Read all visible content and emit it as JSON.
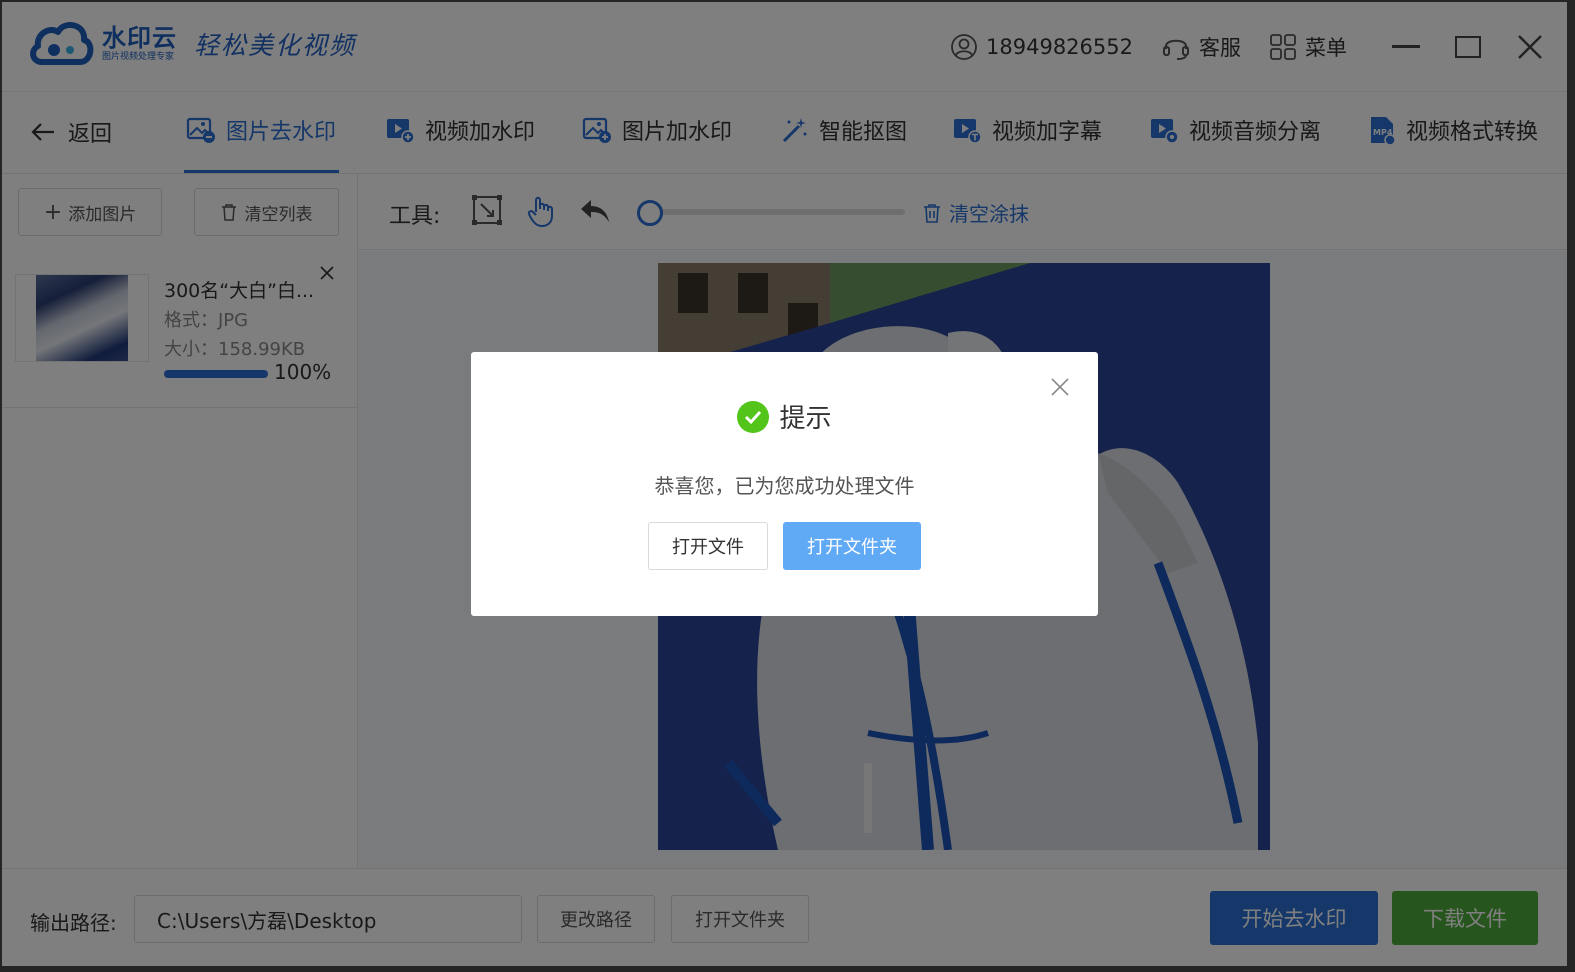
{
  "app": {
    "brand": "水印云",
    "brand_sub": "图片视频处理专家",
    "slogan": "轻松美化视频"
  },
  "titlebar": {
    "phone": "18949826552",
    "service": "客服",
    "menu": "菜单"
  },
  "nav": {
    "back": "返回",
    "tabs": [
      {
        "label": "图片去水印",
        "icon": "image-remove-icon"
      },
      {
        "label": "视频加水印",
        "icon": "video-add-icon"
      },
      {
        "label": "图片加水印",
        "icon": "image-add-icon"
      },
      {
        "label": "智能抠图",
        "icon": "magic-wand-icon"
      },
      {
        "label": "视频加字幕",
        "icon": "video-subtitle-icon"
      },
      {
        "label": "视频音频分离",
        "icon": "video-audio-icon"
      },
      {
        "label": "视频格式转换",
        "icon": "mp4-icon"
      }
    ],
    "active_tab": "图片去水印"
  },
  "sidebar": {
    "add_button": "添加图片",
    "clear_button": "清空列表",
    "files": [
      {
        "name": "300名“大白”白...",
        "format": "格式：JPG",
        "size": "大小：158.99KB",
        "progress_label": "100%",
        "progress": 1.0
      }
    ]
  },
  "toolbar": {
    "label": "工具:",
    "clear_paint": "清空涂抹",
    "brush_size_level": 0.0
  },
  "bottom": {
    "output_label": "输出路径:",
    "output_path": "C:\\Users\\方磊\\Desktop",
    "change_path": "更改路径",
    "open_folder": "打开文件夹",
    "start": "开始去水印",
    "download": "下载文件"
  },
  "dialog": {
    "title": "提示",
    "message": "恭喜您，已为您成功处理文件",
    "open_file": "打开文件",
    "open_folder": "打开文件夹"
  },
  "colors": {
    "accent": "#2a6fd3",
    "success": "#4caa3a",
    "dialog_primary": "#60a9f5",
    "check": "#52c41a"
  }
}
